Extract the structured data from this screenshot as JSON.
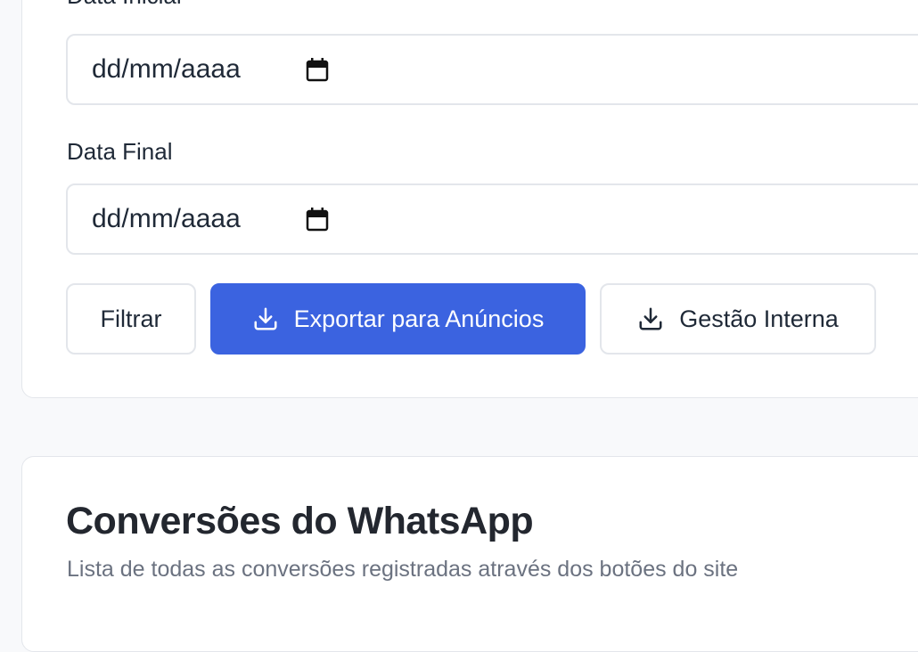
{
  "filters": {
    "start_date": {
      "label": "Data Inicial",
      "value": "dd/mm/aaaa",
      "icon": "calendar-icon"
    },
    "end_date": {
      "label": "Data Final",
      "value": "dd/mm/aaaa",
      "icon": "calendar-icon"
    },
    "buttons": {
      "filter_label": "Filtrar",
      "export_ads_label": "Exportar para Anúncios",
      "export_ads_icon": "download-icon",
      "internal_label": "Gestão Interna",
      "internal_icon": "download-icon"
    }
  },
  "conversions": {
    "title": "Conversões do WhatsApp",
    "subtitle": "Lista de todas as conversões registradas através dos botões do site"
  },
  "colors": {
    "primary": "#3b63e0",
    "border": "#e3e6eb",
    "background": "#f8f9fb",
    "muted_text": "#6b7280"
  }
}
